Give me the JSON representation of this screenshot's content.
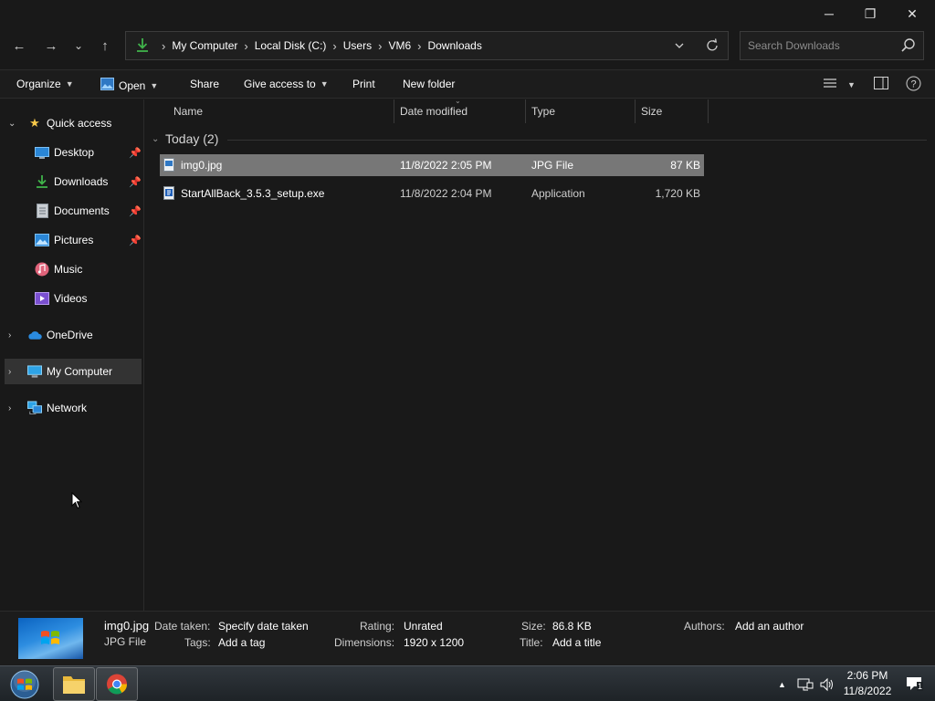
{
  "window": {
    "controls": {
      "minimize": "─",
      "maximize": "❐",
      "close": "✕"
    }
  },
  "navigation": {
    "back": "←",
    "forward": "→",
    "recent": "⌄",
    "up": "↑",
    "breadcrumbs": [
      "My Computer",
      "Local Disk (C:)",
      "Users",
      "VM6",
      "Downloads"
    ],
    "search_placeholder": "Search Downloads"
  },
  "commands": {
    "organize": "Organize",
    "open": "Open",
    "share": "Share",
    "give_access": "Give access to",
    "print": "Print",
    "new_folder": "New folder"
  },
  "sidebar": {
    "quick_access": "Quick access",
    "items": [
      {
        "label": "Desktop",
        "icon": "desktop-icon",
        "pinned": true
      },
      {
        "label": "Downloads",
        "icon": "downloads-icon",
        "pinned": true
      },
      {
        "label": "Documents",
        "icon": "documents-icon",
        "pinned": true
      },
      {
        "label": "Pictures",
        "icon": "pictures-icon",
        "pinned": true
      },
      {
        "label": "Music",
        "icon": "music-icon",
        "pinned": false
      },
      {
        "label": "Videos",
        "icon": "videos-icon",
        "pinned": false
      }
    ],
    "onedrive": "OneDrive",
    "my_computer": "My Computer",
    "network": "Network"
  },
  "columns": {
    "name": "Name",
    "date": "Date modified",
    "type": "Type",
    "size": "Size"
  },
  "group": {
    "label": "Today (2)"
  },
  "files": [
    {
      "name": "img0.jpg",
      "date": "11/8/2022 2:05 PM",
      "type": "JPG File",
      "size": "87 KB",
      "selected": true
    },
    {
      "name": "StartAllBack_3.5.3_setup.exe",
      "date": "11/8/2022 2:04 PM",
      "type": "Application",
      "size": "1,720 KB",
      "selected": false
    }
  ],
  "details": {
    "filename": "img0.jpg",
    "filetype": "JPG File",
    "date_taken_label": "Date taken:",
    "date_taken_value": "Specify date taken",
    "tags_label": "Tags:",
    "tags_value": "Add a tag",
    "rating_label": "Rating:",
    "rating_value": "Unrated",
    "dimensions_label": "Dimensions:",
    "dimensions_value": "1920 x 1200",
    "size_label": "Size:",
    "size_value": "86.8 KB",
    "title_label": "Title:",
    "title_value": "Add a title",
    "authors_label": "Authors:",
    "authors_value": "Add an author"
  },
  "taskbar": {
    "time": "2:06 PM",
    "date": "11/8/2022",
    "notification_count": "1"
  },
  "colors": {
    "background": "#191919",
    "selection": "#777777",
    "sidebar_selected": "#333333",
    "accent_green": "#3fb24a",
    "star_yellow": "#f7c94a"
  }
}
